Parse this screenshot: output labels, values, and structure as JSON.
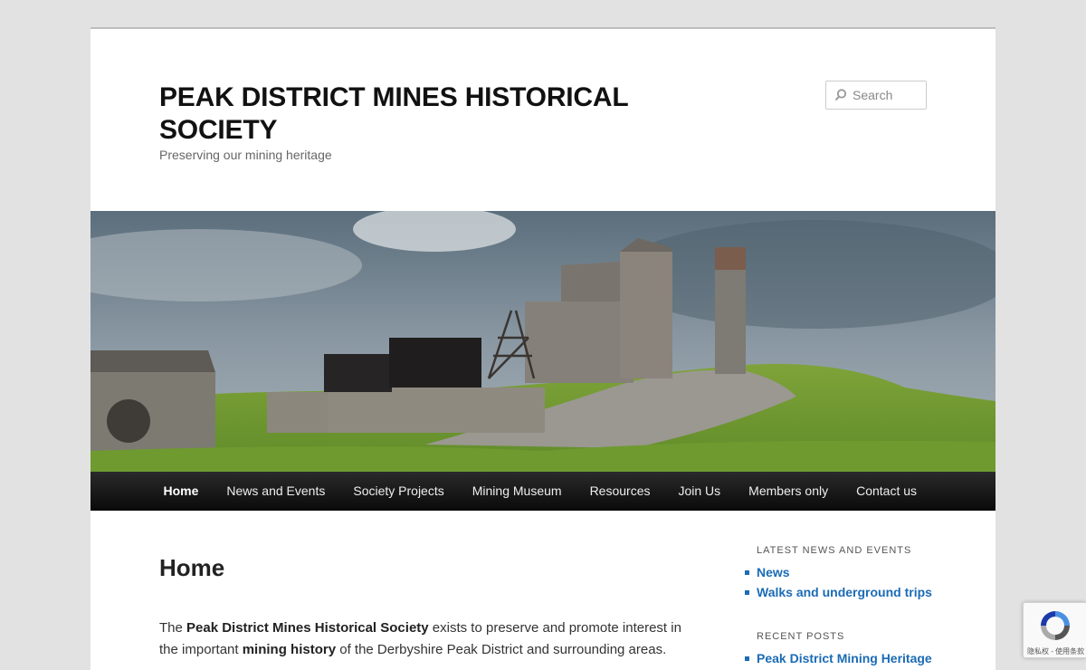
{
  "header": {
    "title": "PEAK DISTRICT MINES HISTORICAL SOCIETY",
    "tagline": "Preserving our mining heritage",
    "search_placeholder": "Search"
  },
  "nav": {
    "items": [
      {
        "label": "Home",
        "active": true
      },
      {
        "label": "News and Events"
      },
      {
        "label": "Society Projects"
      },
      {
        "label": "Mining Museum"
      },
      {
        "label": "Resources"
      },
      {
        "label": "Join Us"
      },
      {
        "label": "Members only"
      },
      {
        "label": "Contact us"
      }
    ]
  },
  "main": {
    "title": "Home",
    "intro": {
      "p1_a": "The ",
      "p1_b": "Peak District Mines Historical Society",
      "p1_c": " exists to preserve and promote interest in the important ",
      "p1_d": "mining history",
      "p1_e": " of the Derbyshire Peak District and surrounding areas."
    }
  },
  "sidebar": {
    "news_title": "LATEST NEWS AND EVENTS",
    "news_items": [
      "News",
      "Walks and underground trips"
    ],
    "recent_title": "RECENT POSTS",
    "recent_items": [
      "Peak District Mining Heritage"
    ]
  },
  "recaptcha": {
    "footer": "隐私权 - 使用条款"
  },
  "colors": {
    "link": "#1b6bb5",
    "nav_bg": "#111111",
    "page_bg": "#e2e2e2"
  }
}
